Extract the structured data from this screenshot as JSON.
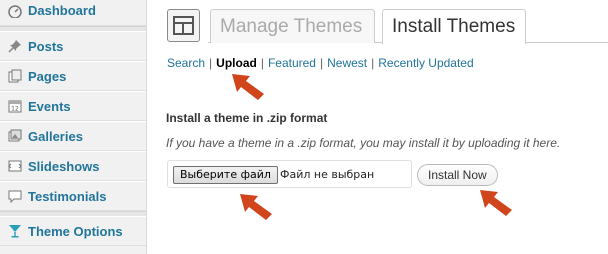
{
  "sidebar": {
    "items": [
      {
        "label": "Dashboard",
        "icon": "dashboard-icon"
      },
      {
        "label": "Posts",
        "icon": "pushpin-icon"
      },
      {
        "label": "Pages",
        "icon": "pages-icon"
      },
      {
        "label": "Events",
        "icon": "calendar-icon"
      },
      {
        "label": "Galleries",
        "icon": "gallery-icon"
      },
      {
        "label": "Slideshows",
        "icon": "slideshow-icon"
      },
      {
        "label": "Testimonials",
        "icon": "speech-bubble-icon"
      },
      {
        "label": "Theme Options",
        "icon": "martini-glass-icon"
      }
    ]
  },
  "tabs": {
    "manage": "Manage Themes",
    "install": "Install Themes"
  },
  "subsub": {
    "search": "Search",
    "upload": "Upload",
    "featured": "Featured",
    "newest": "Newest",
    "recent": "Recently Updated",
    "separator": "|"
  },
  "upload": {
    "heading": "Install a theme in .zip format",
    "description": "If you have a theme in a .zip format, you may install it by uploading it here.",
    "file_button": "Выберите файл",
    "file_status": "Файл не выбран",
    "install_button": "Install Now"
  },
  "colors": {
    "link": "#21759b",
    "arrow": "#d1451d"
  }
}
